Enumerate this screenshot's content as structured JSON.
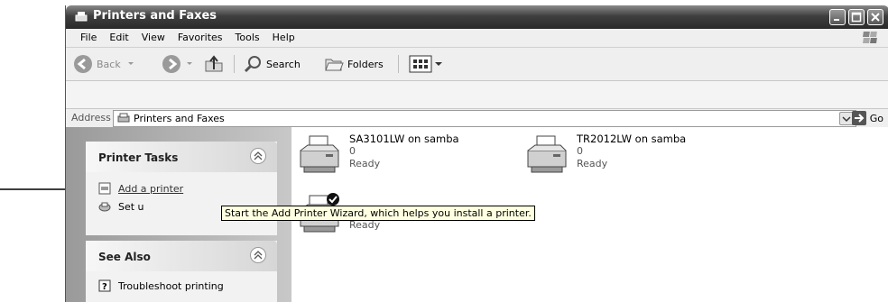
{
  "window": {
    "title": "Printers and Faxes"
  },
  "menu": [
    "File",
    "Edit",
    "View",
    "Favorites",
    "Tools",
    "Help"
  ],
  "toolbar": {
    "back": "Back",
    "search": "Search",
    "folders": "Folders"
  },
  "address": {
    "label": "Address",
    "value": "Printers and Faxes",
    "go": "Go"
  },
  "tasks": {
    "printer_tasks_title": "Printer Tasks",
    "add_printer": "Add a printer",
    "setup_fax_partial": "Set u",
    "see_also_title": "See Also",
    "troubleshoot": "Troubleshoot printing"
  },
  "printers": [
    {
      "name": "SA3101LW on samba",
      "count": "0",
      "status": "Ready"
    },
    {
      "name": "TR2012LW on samba",
      "count": "0",
      "status": "Ready"
    },
    {
      "name": "",
      "count": "",
      "status": "Ready",
      "default": true
    }
  ],
  "tooltip": "Start the Add Printer Wizard, which helps you install a printer."
}
